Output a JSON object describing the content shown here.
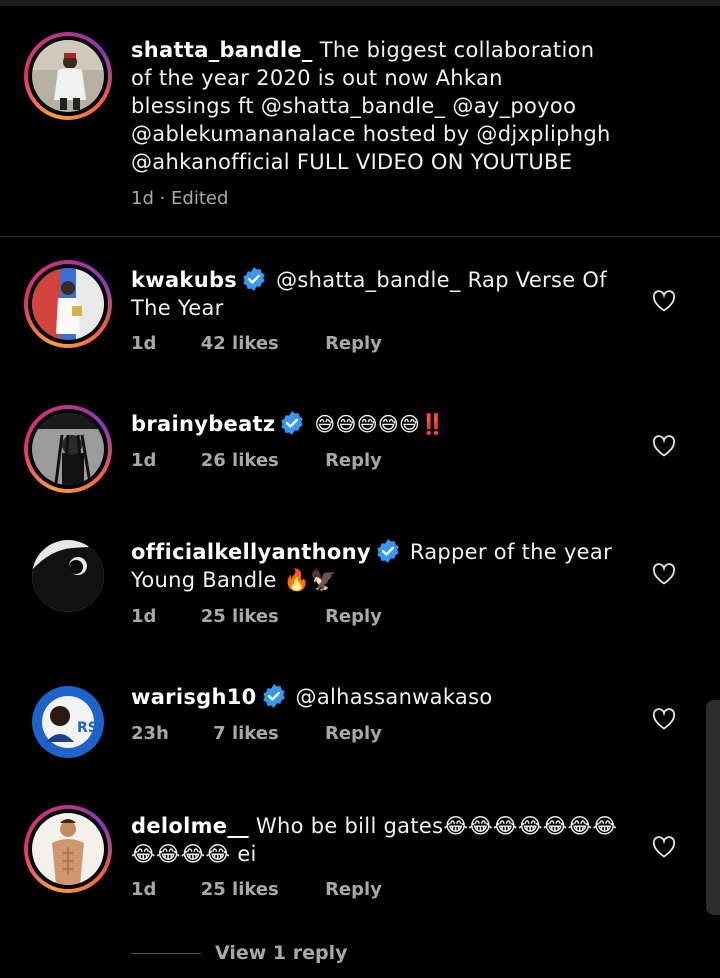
{
  "caption": {
    "username": "shatta_bandle_",
    "text_line1": "The biggest collaboration",
    "text_line2": "of the year 2020 is out now  Ahkan",
    "text_line3": "blessings ft @shatta_bandle_ @ay_poyoo",
    "text_line4": "@ablekumananalace  hosted by @djxpliphgh",
    "text_line5": "@ahkanofficial FULL VIDEO ON YOUTUBE",
    "meta": "1d · Edited"
  },
  "comments": [
    {
      "username": "kwakubs",
      "text": "@shatta_bandle_ Rap Verse Of The Year",
      "time": "1d",
      "likes": "42 likes",
      "reply": "Reply"
    },
    {
      "username": "brainybeatz",
      "text": "😅😅😅😅😅‼️",
      "time": "1d",
      "likes": "26 likes",
      "reply": "Reply"
    },
    {
      "username": "officialkellyanthony",
      "text": "Rapper of the year Young Bandle 🔥🦅",
      "time": "1d",
      "likes": "25 likes",
      "reply": "Reply"
    },
    {
      "username": "warisgh10",
      "text": "@alhassanwakaso",
      "time": "23h",
      "likes": "7 likes",
      "reply": "Reply"
    },
    {
      "username": "delolme__",
      "text": "Who be bill gates😂😂😂😂😂😂😂😂😂😂😂 ei",
      "time": "1d",
      "likes": "25 likes",
      "reply": "Reply"
    }
  ],
  "view_replies": "View 1 reply",
  "colors": {
    "background": "#000000",
    "verified": "#3897f0",
    "secondary_text": "#a8a8a8"
  }
}
